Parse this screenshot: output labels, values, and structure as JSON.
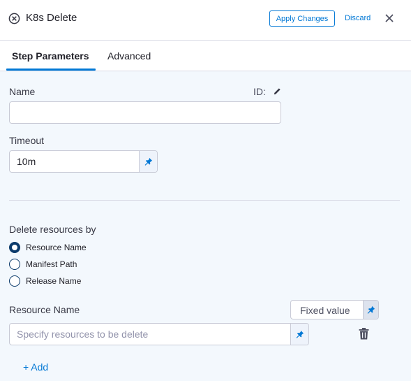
{
  "header": {
    "title": "K8s Delete",
    "step_icon": "x-circle-icon",
    "apply_label": "Apply Changes",
    "discard_label": "Discard",
    "close_icon": "close-icon"
  },
  "tabs": [
    {
      "label": "Step Parameters",
      "active": true
    },
    {
      "label": "Advanced",
      "active": false
    }
  ],
  "form": {
    "name": {
      "label": "Name",
      "value": "",
      "placeholder": ""
    },
    "id_label": "ID:",
    "timeout": {
      "label": "Timeout",
      "value": "10m"
    },
    "delete_by": {
      "label": "Delete resources by",
      "options": [
        {
          "label": "Resource Name",
          "selected": true
        },
        {
          "label": "Manifest Path",
          "selected": false
        },
        {
          "label": "Release Name",
          "selected": false
        }
      ]
    },
    "resource_name": {
      "label": "Resource Name",
      "mode_label": "Fixed value",
      "value": "",
      "placeholder": "Specify resources to be delete"
    },
    "add_label": "+ Add"
  },
  "colors": {
    "accent": "#0278d5",
    "panel_bg": "#f3f8fd",
    "radio": "#0b3a6b"
  }
}
